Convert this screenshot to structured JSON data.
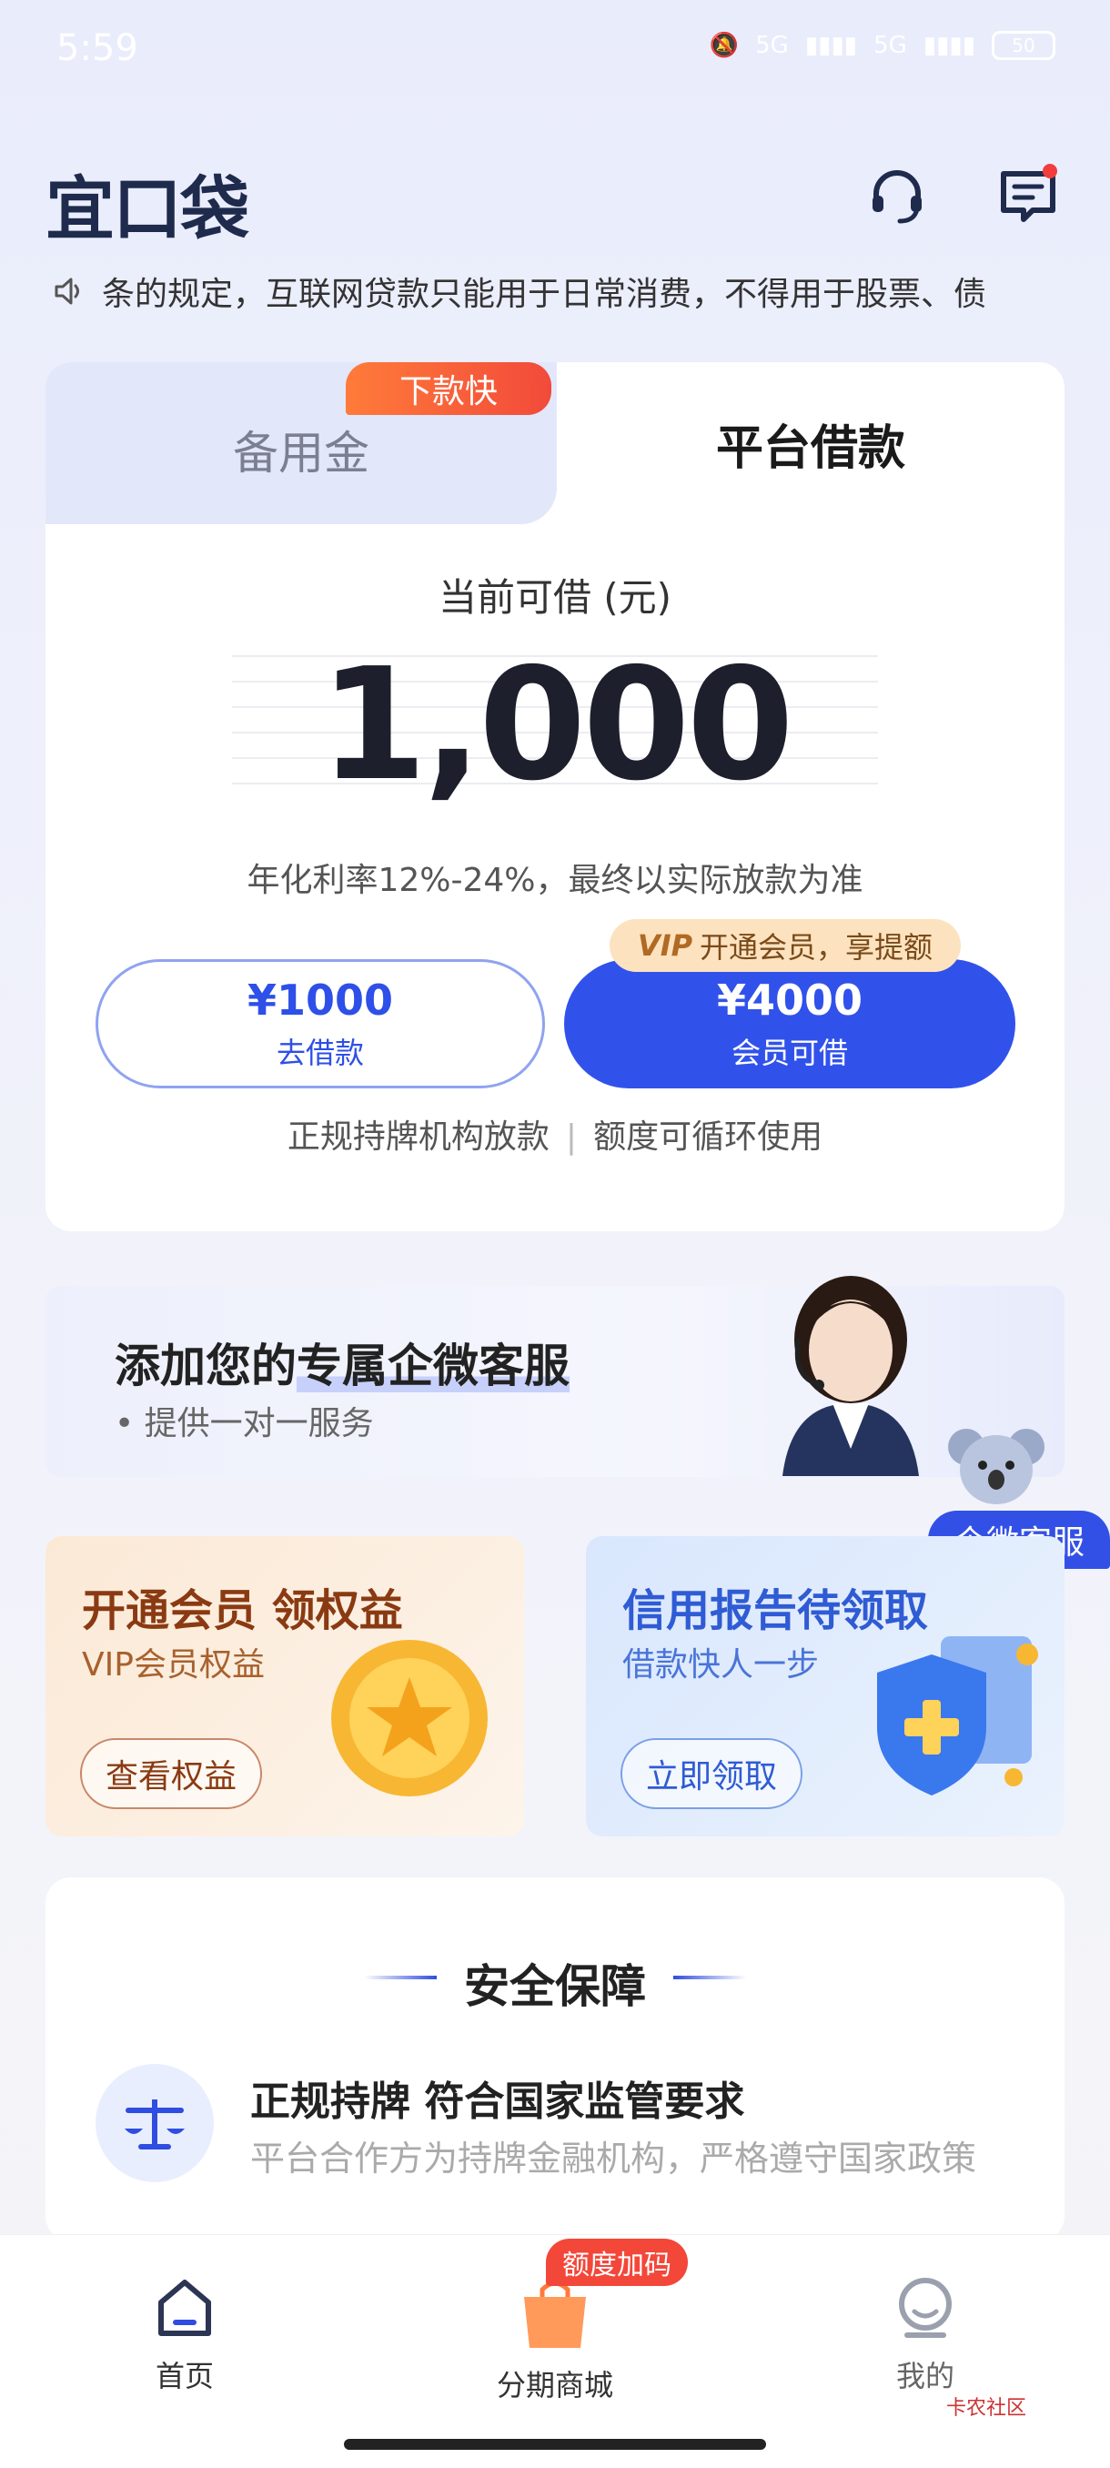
{
  "status_bar": {
    "time": "5:59",
    "signal1": "5G",
    "signal2": "5G",
    "battery": "50"
  },
  "header": {
    "logo": "宜口袋"
  },
  "notice": {
    "text": "条的规定，互联网贷款只能用于日常消费，不得用于股票、债"
  },
  "loan_card": {
    "tab_left": "备用金",
    "tab_left_badge": "下款快",
    "tab_right": "平台借款",
    "available_label": "当前可借 (元)",
    "amount": "1,000",
    "rate_text": "年化利率12%-24%，最终以实际放款为准",
    "borrow_button": {
      "amount": "¥1000",
      "label": "去借款"
    },
    "vip_button": {
      "amount": "¥4000",
      "label": "会员可借"
    },
    "vip_tag": {
      "mark": "VIP",
      "text": "开通会员，享提额"
    },
    "license_left": "正规持牌机构放款",
    "license_right": "额度可循环使用"
  },
  "service_banner": {
    "title_prefix": "添加您的",
    "title_highlight": "专属企微客服",
    "subtitle": "• 提供一对一服务",
    "float_tag": "企微客服"
  },
  "promos": [
    {
      "title": "开通会员 领权益",
      "subtitle": "VIP会员权益",
      "button": "查看权益",
      "color": "#8a3a12"
    },
    {
      "title": "信用报告待领取",
      "subtitle": "借款快人一步",
      "button": "立即领取",
      "color": "#2f5bd4"
    }
  ],
  "safety": {
    "title": "安全保障",
    "item_title": "正规持牌 符合国家监管要求",
    "item_desc": "平台合作方为持牌金融机构，严格遵守国家政策"
  },
  "bottom_nav": {
    "home": "首页",
    "mall": "分期商城",
    "mall_badge": "额度加码",
    "mine": "我的"
  },
  "watermark": "卡农社区",
  "colors": {
    "primary": "#3152ea",
    "accent_red": "#f24a3a",
    "vip_gold": "#fde2bf"
  }
}
